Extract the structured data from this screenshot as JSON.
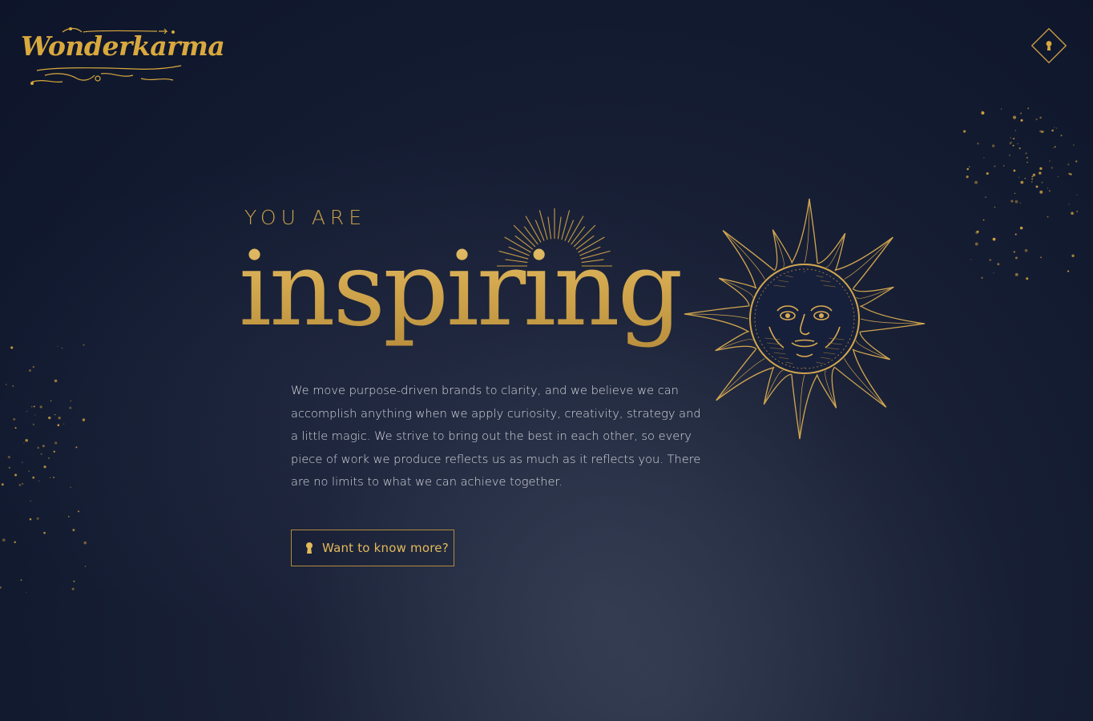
{
  "brand": {
    "logo_text": "Wonderkarma",
    "accent_color": "#d9a93e",
    "background_color": "#141b31"
  },
  "header": {
    "menu_icon": "keyhole-icon"
  },
  "hero": {
    "eyebrow": "YOU ARE",
    "headline": "inspiring",
    "illustration": "sun-face-icon",
    "description": "We move purpose-driven brands to clarity, and we believe we can accomplish anything when we apply curiosity, creativity, strategy and a little magic. We strive to bring out the best in each other, so every piece of work we produce reflects us as much as it reflects you. There are no limits to what we can achieve together.",
    "cta": {
      "label": "Want to know more?",
      "icon": "keyhole-icon"
    }
  }
}
